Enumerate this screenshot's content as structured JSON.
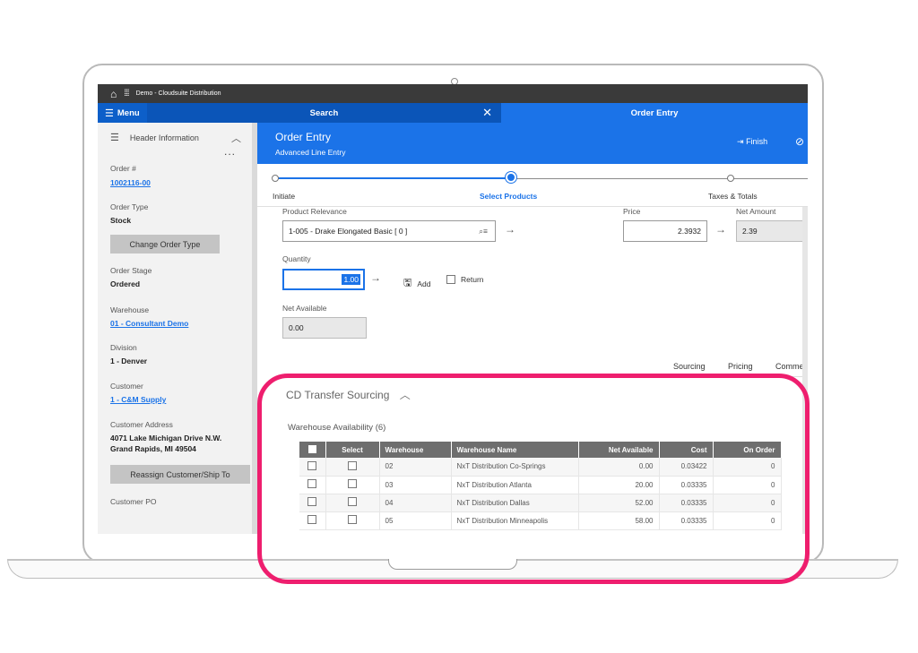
{
  "top_bar": {
    "app_title": "Demo - Cloudsuite Distribution"
  },
  "nav": {
    "menu_label": "Menu",
    "search_label": "Search",
    "order_entry_label": "Order Entry"
  },
  "sidebar": {
    "header": "Header Information",
    "more": "...",
    "order_label": "Order #",
    "order_value": "1002116-00",
    "order_type_label": "Order Type",
    "order_type_value": "Stock",
    "change_order_type": "Change Order Type",
    "order_stage_label": "Order Stage",
    "order_stage_value": "Ordered",
    "warehouse_label": "Warehouse",
    "warehouse_value": "01 - Consultant Demo",
    "division_label": "Division",
    "division_value": "1 - Denver",
    "customer_label": "Customer",
    "customer_value": "1 - C&M Supply",
    "customer_address_label": "Customer Address",
    "address_line1": "4071 Lake Michigan Drive N.W.",
    "address_line2": "Grand Rapids, MI 49504",
    "reassign_button": "Reassign Customer/Ship To",
    "customer_po_label": "Customer PO"
  },
  "order_entry": {
    "title": "Order Entry",
    "subtitle": "Advanced Line Entry",
    "finish": "Finish",
    "steps": [
      "Initiate",
      "Select Products",
      "Taxes & Totals"
    ]
  },
  "form": {
    "product_label": "Product Relevance",
    "product_value": "1-005 - Drake Elongated Basic  [ 0 ]",
    "price_label": "Price",
    "price_value": "2.3932",
    "net_amount_label": "Net Amount",
    "net_amount_value": "2.39",
    "quantity_label": "Quantity",
    "quantity_value": "1.00",
    "add_label": "Add",
    "return_label": "Return",
    "net_available_label": "Net Available",
    "net_available_value": "0.00",
    "tabs": [
      "Sourcing",
      "Pricing",
      "Commer"
    ]
  },
  "cd_transfer": {
    "title": "CD Transfer Sourcing",
    "availability_title": "Warehouse Availability (6)",
    "columns": [
      "Select",
      "Warehouse",
      "Warehouse Name",
      "Net Available",
      "Cost",
      "On Order"
    ],
    "rows": [
      {
        "warehouse": "02",
        "name": "NxT Distribution Co-Springs",
        "net_available": "0.00",
        "cost": "0.03422",
        "on_order": "0"
      },
      {
        "warehouse": "03",
        "name": "NxT Distribution Atlanta",
        "net_available": "20.00",
        "cost": "0.03335",
        "on_order": "0"
      },
      {
        "warehouse": "04",
        "name": "NxT Distribution Dallas",
        "net_available": "52.00",
        "cost": "0.03335",
        "on_order": "0"
      },
      {
        "warehouse": "05",
        "name": "NxT Distribution Minneapolis",
        "net_available": "58.00",
        "cost": "0.03335",
        "on_order": "0"
      }
    ]
  },
  "colors": {
    "brand_blue": "#1b73e8",
    "highlight": "#ee1e6e",
    "top_bar": "#3a3a3a"
  }
}
